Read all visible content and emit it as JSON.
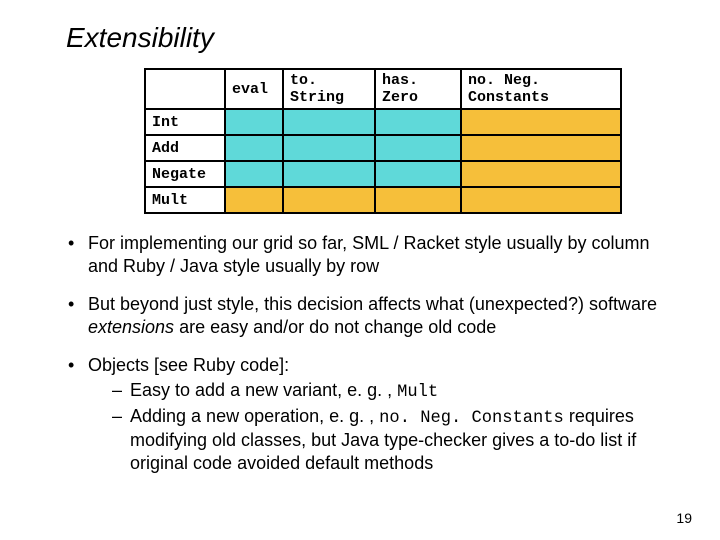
{
  "title": "Extensibility",
  "table": {
    "cols": [
      "eval",
      "to. String",
      "has. Zero",
      "no. Neg. Constants"
    ],
    "rows": [
      "Int",
      "Add",
      "Negate",
      "Mult"
    ],
    "new_col_index": 3,
    "new_row_index": 3
  },
  "bullets": {
    "b1": {
      "pre": "For implementing our grid so far, SML / Racket style usually by column and Ruby / Java style usually by row"
    },
    "b2": {
      "pre": "But beyond just style, this decision affects what (unexpected?) software ",
      "em": "extensions",
      "post": " are easy and/or do not change old code"
    },
    "b3": {
      "pre": "Objects [see Ruby code]:",
      "sub1": {
        "pre": "Easy to add a new variant, e. g. , ",
        "code": "Mult"
      },
      "sub2": {
        "pre": "Adding a new operation, e. g. , ",
        "code": "no. Neg. Constants",
        "post": " requires modifying old classes, but Java type-checker gives a to-do list if original code avoided default methods"
      }
    }
  },
  "pagenum": "19"
}
